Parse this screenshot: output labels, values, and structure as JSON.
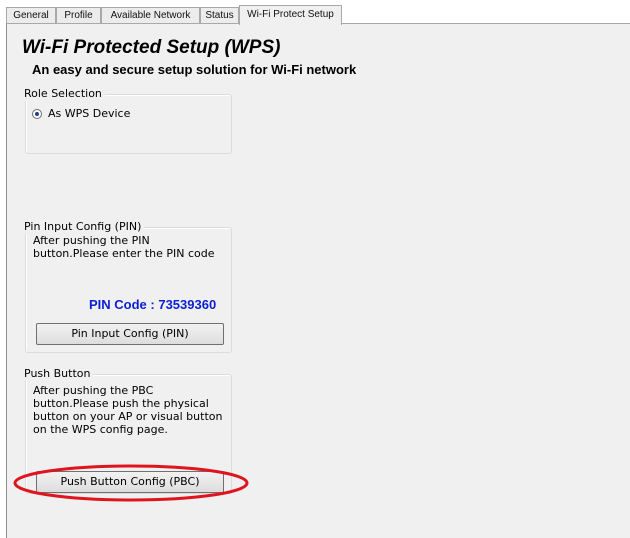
{
  "tabs": [
    "General",
    "Profile",
    "Available Network",
    "Status",
    "Wi-Fi Protect Setup"
  ],
  "active_tab": "Wi-Fi Protect Setup",
  "header": {
    "title": "Wi-Fi Protected Setup (WPS)",
    "subtitle": "An easy and secure setup solution for Wi-Fi network"
  },
  "role_selection": {
    "legend": "Role Selection",
    "option_label": "As WPS Device",
    "selected": true
  },
  "pin_section": {
    "legend": "Pin Input Config (PIN)",
    "description_lines": [
      "After pushing the PIN",
      "button.Please enter the PIN code"
    ],
    "pin_label": "PIN Code : ",
    "pin_value": "73539360",
    "button_label": "Pin Input Config (PIN)"
  },
  "pbc_section": {
    "legend": "Push Button",
    "description_lines": [
      "After pushing the PBC",
      "button.Please push the physical",
      "button on your AP or visual button",
      "on the WPS config page."
    ],
    "button_label": "Push Button Config (PBC)"
  },
  "colors": {
    "panel_bg": "#f0f0f0",
    "pin_text": "#0b1fd6",
    "highlight_oval": "#e0141e"
  }
}
